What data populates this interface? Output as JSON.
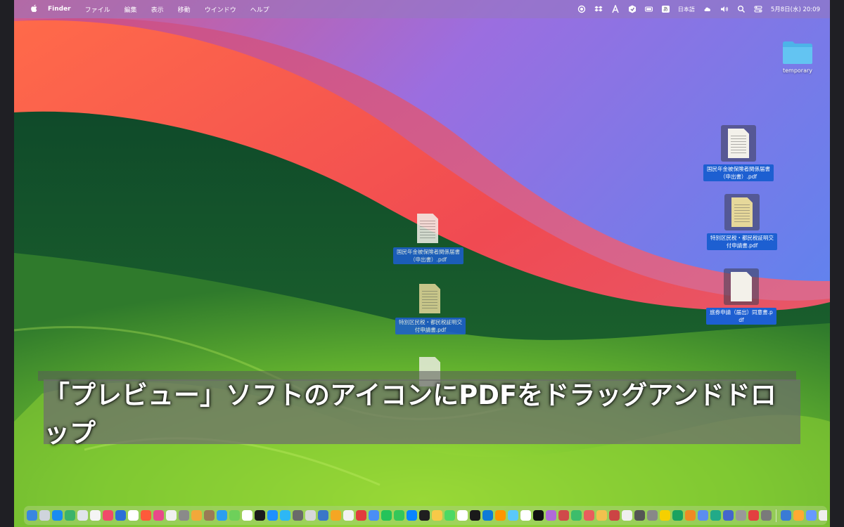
{
  "menubar": {
    "app_name": "Finder",
    "menus": [
      "ファイル",
      "編集",
      "表示",
      "移動",
      "ウインドウ",
      "ヘルプ"
    ],
    "input_source": "日本語",
    "datetime": "5月8日(水) 20:09"
  },
  "desktop": {
    "folder": {
      "label": "temporary"
    },
    "files_right": [
      {
        "label": "国民年金被保険者関係届書（申出書）.pdf",
        "style": "scan"
      },
      {
        "label": "特別区民税・都民税証明交付申請書.pdf",
        "style": "yellow"
      },
      {
        "label": "旅券申請（届出）同意書.pdf",
        "style": "blank"
      }
    ],
    "files_dragging": [
      {
        "label": "国民年金被保険者関係届書（申出書）.pdf",
        "style": "scan"
      },
      {
        "label": "特別区民税・都民税証明交付申請書.pdf",
        "style": "yellow"
      }
    ]
  },
  "caption": {
    "text": "「プレビュー」ソフトのアイコンにPDFをドラッグアンドドロップ"
  },
  "dock": {
    "app_colors": [
      "#3a86e0",
      "#cfd4dc",
      "#1a8cf0",
      "#3bb36a",
      "#e0e4ea",
      "#f4f4f4",
      "#f04a6a",
      "#2b6fd8",
      "#ffffff",
      "#ff5a3a",
      "#e84a8a",
      "#f0f0f0",
      "#8a8a8a",
      "#f2a83a",
      "#9b7a55",
      "#2c9ef0",
      "#6ed05a",
      "#ffffff",
      "#1c1c1c",
      "#1e90ff",
      "#2db7f5",
      "#6a6a6a",
      "#d8d8d8",
      "#3a77c8",
      "#f5a623",
      "#f2f2f2",
      "#e23c3c",
      "#4a8ef5",
      "#25c35a",
      "#34c759",
      "#0a84ff",
      "#1f1f1f",
      "#f7c948",
      "#4cd964",
      "#ffffff",
      "#1a1a1a",
      "#0f7bd8",
      "#ff9500",
      "#5ac8fa",
      "#ffffff",
      "#111111",
      "#b06ad8",
      "#d04a4a",
      "#3dbd6b",
      "#e85d5d",
      "#f2c14e",
      "#cc4444",
      "#efefef",
      "#555555",
      "#888888",
      "#f5d000",
      "#1aa260",
      "#f08a24",
      "#5b8def",
      "#22aa88",
      "#4466cc",
      "#999999",
      "#e34040",
      "#7a7a7a",
      "#3a7bd5",
      "#ffaa33",
      "#6699ff",
      "#eeeeee",
      "#c0c0c0"
    ]
  }
}
